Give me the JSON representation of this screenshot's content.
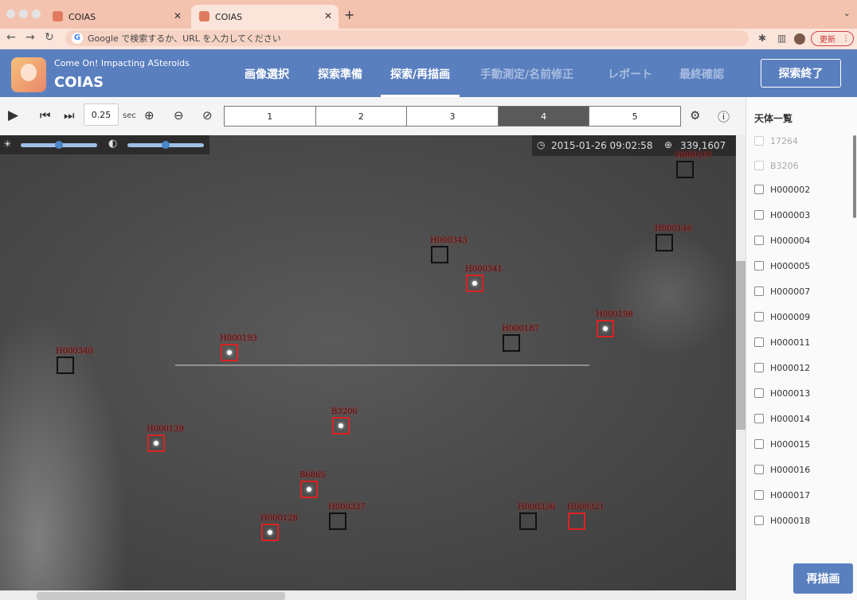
{
  "browser": {
    "tabs": [
      {
        "title": "COIAS"
      },
      {
        "title": "COIAS"
      }
    ],
    "address_placeholder": "Google で検索するか、URL を入力してください",
    "update_label": "更新"
  },
  "app": {
    "subtitle": "Come On! Impacting ASteroids",
    "title": "COIAS",
    "nav": [
      "画像選択",
      "探索準備",
      "探索/再描画",
      "手動測定/名前修正",
      "レポート",
      "最終確認"
    ],
    "end_button": "探索終了"
  },
  "toolbar": {
    "speed": "0.25",
    "speed_unit": "sec",
    "frames": [
      "1",
      "2",
      "3",
      "4",
      "5"
    ],
    "active_frame": "4"
  },
  "image": {
    "datetime": "2015-01-26 09:02:58",
    "coord": "339,1607",
    "brightness": 0.5,
    "contrast": 0.5,
    "markers": [
      {
        "label": "H000107",
        "color": "black"
      },
      {
        "label": "H000146",
        "color": "black"
      },
      {
        "label": "H000343",
        "color": "black"
      },
      {
        "label": "H000341",
        "color": "red"
      },
      {
        "label": "H000198",
        "color": "red"
      },
      {
        "label": "H000187",
        "color": "black"
      },
      {
        "label": "H000193",
        "color": "red"
      },
      {
        "label": "H000340",
        "color": "black"
      },
      {
        "label": "B3206",
        "color": "red"
      },
      {
        "label": "H000139",
        "color": "red"
      },
      {
        "label": "B6865",
        "color": "red"
      },
      {
        "label": "H000337",
        "color": "black"
      },
      {
        "label": "H000336",
        "color": "black"
      },
      {
        "label": "H000321",
        "color": "red"
      },
      {
        "label": "H000128",
        "color": "red"
      }
    ]
  },
  "sidebar": {
    "title": "天体一覧",
    "items": [
      {
        "label": "17264",
        "disabled": true
      },
      {
        "label": "B3206",
        "disabled": true
      },
      {
        "label": "H000002",
        "disabled": false
      },
      {
        "label": "H000003",
        "disabled": false
      },
      {
        "label": "H000004",
        "disabled": false
      },
      {
        "label": "H000005",
        "disabled": false
      },
      {
        "label": "H000007",
        "disabled": false
      },
      {
        "label": "H000009",
        "disabled": false
      },
      {
        "label": "H000011",
        "disabled": false
      },
      {
        "label": "H000012",
        "disabled": false
      },
      {
        "label": "H000013",
        "disabled": false
      },
      {
        "label": "H000014",
        "disabled": false
      },
      {
        "label": "H000015",
        "disabled": false
      },
      {
        "label": "H000016",
        "disabled": false
      },
      {
        "label": "H000017",
        "disabled": false
      },
      {
        "label": "H000018",
        "disabled": false
      }
    ],
    "redraw_button": "再描画"
  },
  "colors": {
    "header": "#5a7fbf",
    "accent": "#4b86c8",
    "marker_red": "#d22222"
  },
  "icons": [
    "play-icon",
    "step-back-icon",
    "step-forward-icon",
    "zoom-in-icon",
    "zoom-out-icon",
    "eye-off-icon",
    "gear-icon",
    "help-icon",
    "brightness-icon",
    "contrast-icon",
    "clock-icon",
    "crosshair-icon"
  ]
}
